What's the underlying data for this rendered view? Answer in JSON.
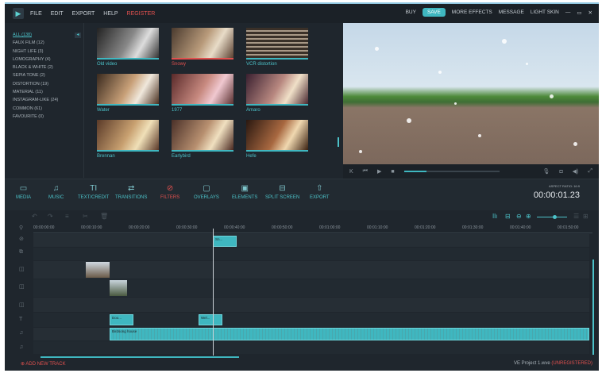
{
  "menu": {
    "items": [
      "FILE",
      "EDIT",
      "EXPORT",
      "HELP"
    ],
    "register": "REGISTER"
  },
  "topright": {
    "buy": "BUY",
    "save": "SAVE",
    "more_effects": "MORE EFFECTS",
    "message": "MESSAGE",
    "light_skin": "LIGHT SKIN"
  },
  "categories": [
    "ALL (138)",
    "FAUX FILM (12)",
    "NIGHT LIFE (3)",
    "LOMOGRAPHY (4)",
    "BLACK & WHITE (2)",
    "SEPIA TONE (2)",
    "DISTORTION (19)",
    "MATERIAL (11)",
    "INSTAGRAM-LIKE (24)",
    "COMMON (61)",
    "FAVOURITE (0)"
  ],
  "filters": [
    "Old video",
    "Snowy",
    "VCR distortion",
    "Water",
    "1977",
    "Amaro",
    "Brennan",
    "Earlybird",
    "Hefe"
  ],
  "toolbar": [
    "MEDIA",
    "MUSIC",
    "TEXT/CREDIT",
    "TRANSITIONS",
    "FILTERS",
    "OVERLAYS",
    "ELEMENTS",
    "SPLIT SCREEN",
    "EXPORT"
  ],
  "aspect_ratio": "ASPECT RATIO: 16:9",
  "timecode": "00:00:01.23",
  "ruler": [
    "00:00:00:00",
    "00:00:10:00",
    "00:00:20:00",
    "00:00:30:00",
    "00:00:40:00",
    "00:00:50:00",
    "00:01:00:00",
    "00:01:10:00",
    "00:01:20:00",
    "00:01:30:00",
    "00:01:40:00",
    "00:01:50:00"
  ],
  "clips": {
    "text1": "Doo...",
    "text2": "Wel...",
    "filter": "Sn...",
    "audio": "Birdsong house"
  },
  "bottom": {
    "add_track": "ADD NEW TRACK",
    "project": "VE Project 1.wve",
    "unregistered": "(UNREGISTERED)"
  },
  "colors": {
    "accent": "#3fb7c0",
    "active": "#e0504e"
  }
}
